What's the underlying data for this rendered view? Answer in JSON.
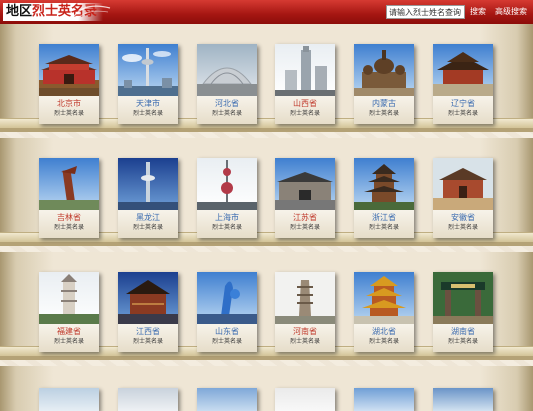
{
  "header": {
    "logo_part1": "地区",
    "logo_part2": "烈士英名录",
    "search_placeholder": "请输入烈士姓名查询",
    "search_button": "搜索",
    "advanced_search": "高级搜索"
  },
  "rows": [
    {
      "cards": [
        {
          "name": "北京市",
          "sub": "烈士英名录",
          "color": "#c0392b",
          "icon": "tiananmen-icon"
        },
        {
          "name": "天津市",
          "sub": "烈士英名录",
          "color": "#3a6bb0",
          "icon": "tv-tower-icon"
        },
        {
          "name": "河北省",
          "sub": "烈士英名录",
          "color": "#3a6bb0",
          "icon": "building-icon"
        },
        {
          "name": "山西省",
          "sub": "烈士英名录",
          "color": "#c0392b",
          "icon": "tower-building-icon"
        },
        {
          "name": "内蒙古",
          "sub": "烈士英名录",
          "color": "#3a6bb0",
          "icon": "domed-hall-icon"
        },
        {
          "name": "辽宁省",
          "sub": "烈士英名录",
          "color": "#3a6bb0",
          "icon": "palace-icon"
        }
      ]
    },
    {
      "cards": [
        {
          "name": "吉林省",
          "sub": "烈士英名录",
          "color": "#c0392b",
          "icon": "monument-icon"
        },
        {
          "name": "黑龙江",
          "sub": "烈士英名录",
          "color": "#3a6bb0",
          "icon": "tv-tower-icon"
        },
        {
          "name": "上海市",
          "sub": "烈士英名录",
          "color": "#3a6bb0",
          "icon": "pearl-tower-icon"
        },
        {
          "name": "江苏省",
          "sub": "烈士英名录",
          "color": "#c0392b",
          "icon": "city-gate-icon"
        },
        {
          "name": "浙江省",
          "sub": "烈士英名录",
          "color": "#3a6bb0",
          "icon": "pagoda-icon"
        },
        {
          "name": "安徽省",
          "sub": "烈士英名录",
          "color": "#3a6bb0",
          "icon": "temple-icon"
        }
      ]
    },
    {
      "cards": [
        {
          "name": "福建省",
          "sub": "烈士英名录",
          "color": "#c0392b",
          "icon": "pagoda-icon"
        },
        {
          "name": "江西省",
          "sub": "烈士英名录",
          "color": "#3a6bb0",
          "icon": "pavilion-icon"
        },
        {
          "name": "山东省",
          "sub": "烈士英名录",
          "color": "#3a6bb0",
          "icon": "sculpture-icon"
        },
        {
          "name": "河南省",
          "sub": "烈士英名录",
          "color": "#c0392b",
          "icon": "stone-pagoda-icon"
        },
        {
          "name": "湖北省",
          "sub": "烈士英名录",
          "color": "#3a6bb0",
          "icon": "yellow-crane-tower-icon"
        },
        {
          "name": "湖南省",
          "sub": "烈士英名录",
          "color": "#3a6bb0",
          "icon": "gate-icon"
        }
      ]
    }
  ]
}
